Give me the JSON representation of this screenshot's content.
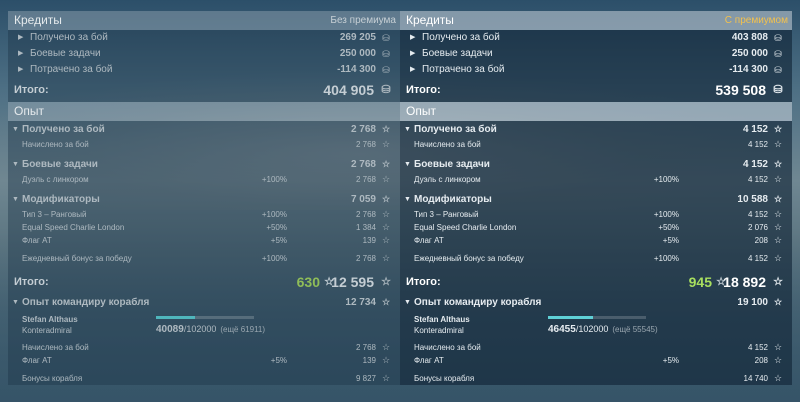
{
  "left": {
    "credits_header": "Кредиты",
    "credits_tag": "Без премиума",
    "credit_rows": [
      {
        "label": "Получено за бой",
        "value": "269 205"
      },
      {
        "label": "Боевые задачи",
        "value": "250 000"
      },
      {
        "label": "Потрачено за бой",
        "value": "-114 300"
      }
    ],
    "credits_total_label": "Итого:",
    "credits_total_value": "404 905",
    "exp_header": "Опыт",
    "battle": {
      "label": "Получено за бой",
      "value": "2 768"
    },
    "battle_sub": {
      "label": "Начислено за бой",
      "value": "2 768"
    },
    "tasks": {
      "label": "Боевые задачи",
      "value": "2 768"
    },
    "tasks_sub": {
      "label": "Дуэль с линкором",
      "pct": "+100%",
      "value": "2 768"
    },
    "mods": {
      "label": "Модификаторы",
      "value": "7 059"
    },
    "mod_rows": [
      {
        "label": "Тип 3 – Ранговый",
        "pct": "+100%",
        "value": "2 768"
      },
      {
        "label": "Equal Speed Charlie London",
        "pct": "+50%",
        "value": "1 384"
      },
      {
        "label": "Флаг AT",
        "pct": "+5%",
        "value": "139"
      }
    ],
    "daily": {
      "label": "Ежедневный бонус за победу",
      "pct": "+100%",
      "value": "2 768"
    },
    "exp_total_label": "Итого:",
    "exp_total_free": "630",
    "exp_total_value": "12 595",
    "cmdr": {
      "label": "Опыт командиру корабля",
      "value": "12 734"
    },
    "cmdr_name": "Stefan Althaus",
    "cmdr_rank": "Konteradmiral",
    "cmdr_current": "40089",
    "cmdr_max": "/102000",
    "cmdr_hint": "(ещё 61911)",
    "cmdr_progress": 0.393,
    "cmdr_rows": [
      {
        "label": "Начислено за бой",
        "pct": "",
        "value": "2 768"
      },
      {
        "label": "Флаг AT",
        "pct": "+5%",
        "value": "139"
      }
    ],
    "ship_bonus": {
      "label": "Бонусы корабля",
      "value": "9 827"
    }
  },
  "right": {
    "credits_header": "Кредиты",
    "credits_tag": "С премиумом",
    "credit_rows": [
      {
        "label": "Получено за бой",
        "value": "403 808"
      },
      {
        "label": "Боевые задачи",
        "value": "250 000"
      },
      {
        "label": "Потрачено за бой",
        "value": "-114 300"
      }
    ],
    "credits_total_label": "Итого:",
    "credits_total_value": "539 508",
    "exp_header": "Опыт",
    "battle": {
      "label": "Получено за бой",
      "value": "4 152"
    },
    "battle_sub": {
      "label": "Начислено за бой",
      "value": "4 152"
    },
    "tasks": {
      "label": "Боевые задачи",
      "value": "4 152"
    },
    "tasks_sub": {
      "label": "Дуэль с линкором",
      "pct": "+100%",
      "value": "4 152"
    },
    "mods": {
      "label": "Модификаторы",
      "value": "10 588"
    },
    "mod_rows": [
      {
        "label": "Тип 3 – Ранговый",
        "pct": "+100%",
        "value": "4 152"
      },
      {
        "label": "Equal Speed Charlie London",
        "pct": "+50%",
        "value": "2 076"
      },
      {
        "label": "Флаг AT",
        "pct": "+5%",
        "value": "208"
      }
    ],
    "daily": {
      "label": "Ежедневный бонус за победу",
      "pct": "+100%",
      "value": "4 152"
    },
    "exp_total_label": "Итого:",
    "exp_total_free": "945",
    "exp_total_value": "18 892",
    "cmdr": {
      "label": "Опыт командиру корабля",
      "value": "19 100"
    },
    "cmdr_name": "Stefan Althaus",
    "cmdr_rank": "Konteradmiral",
    "cmdr_current": "46455",
    "cmdr_max": "/102000",
    "cmdr_hint": "(ещё 55545)",
    "cmdr_progress": 0.455,
    "cmdr_rows": [
      {
        "label": "Начислено за бой",
        "pct": "",
        "value": "4 152"
      },
      {
        "label": "Флаг AT",
        "pct": "+5%",
        "value": "208"
      }
    ],
    "ship_bonus": {
      "label": "Бонусы корабля",
      "value": "14 740"
    }
  },
  "icons": {
    "credit": "coin-stack-icon",
    "exp": "star-icon",
    "expand": "arrow-icon"
  }
}
